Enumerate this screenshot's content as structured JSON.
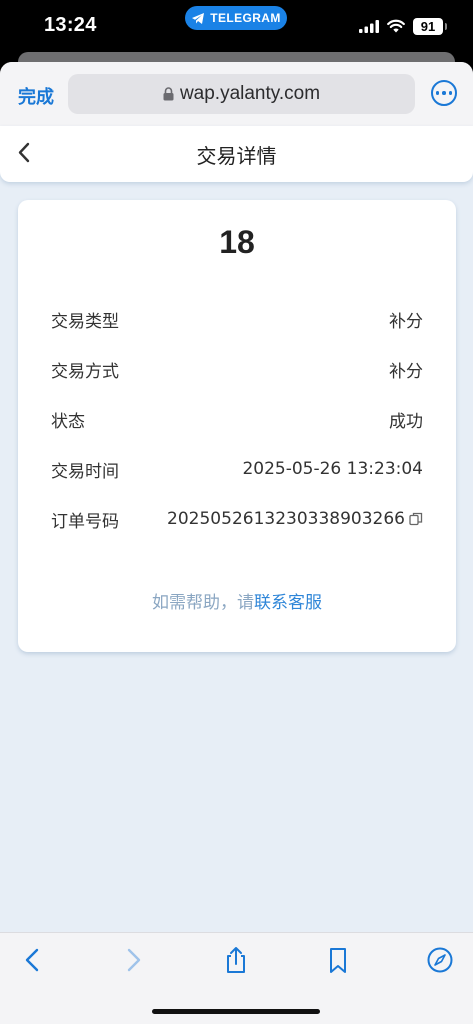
{
  "status_bar": {
    "time": "13:24",
    "app_pill": "TELEGRAM",
    "battery": "91"
  },
  "browser": {
    "done_label": "完成",
    "url": "wap.yalanty.com"
  },
  "page": {
    "title": "交易详情",
    "amount": "18",
    "rows": [
      {
        "label": "交易类型",
        "value": "补分"
      },
      {
        "label": "交易方式",
        "value": "补分"
      },
      {
        "label": "状态",
        "value": "成功"
      },
      {
        "label": "交易时间",
        "value": "2025-05-26 13:23:04"
      },
      {
        "label": "订单号码",
        "value": "20250526132303389032​66"
      }
    ],
    "help_prefix": "如需帮助，请",
    "help_link": "联系客服"
  },
  "colors": {
    "accent": "#1a78d6",
    "telegram": "#1a82e6",
    "page_bg": "#e7eef6"
  },
  "icons": [
    "telegram-icon",
    "signal-icon",
    "wifi-icon",
    "lock-icon",
    "more-icon",
    "back-icon",
    "copy-icon",
    "share-icon",
    "bookmark-icon",
    "compass-icon"
  ]
}
